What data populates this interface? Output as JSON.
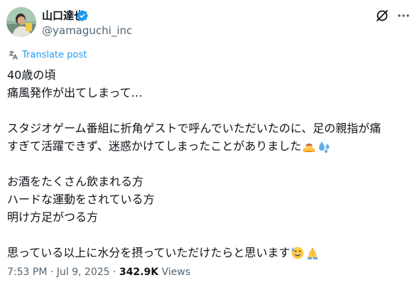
{
  "author": {
    "display_name": "山口達也",
    "handle": "@yamaguchi_inc",
    "verified": true,
    "avatar_icon": "profile-photo",
    "verified_color": "#1d9bf0"
  },
  "header": {
    "grok_icon": "grok-icon",
    "more_icon": "more-icon"
  },
  "translate": {
    "label": "Translate post",
    "icon": "translate-icon",
    "color": "#1d9bf0"
  },
  "post": {
    "lines": [
      "40歳の頃",
      "痛風発作が出てしまって…",
      "",
      "スタジオゲーム番組に折角ゲストで呼んでいただいたのに、足の親指が痛",
      "すぎて活躍できず、迷惑かけてしまったことがありました",
      "",
      "お酒をたくさん飲まれる方",
      "ハードな運動をされている方",
      "明け方足がつる方",
      "",
      "思っている以上に水分を摂っていただけたらと思います"
    ],
    "line5_emojis": [
      "bowing-person-emoji",
      "sweat-droplets-emoji"
    ],
    "line11_emojis": [
      "grinning-sweat-emoji",
      "folded-hands-emoji"
    ]
  },
  "meta": {
    "time": "7:53 PM",
    "separator": "·",
    "date": "Jul 9, 2025",
    "views_count": "342.9K",
    "views_label": "Views"
  }
}
